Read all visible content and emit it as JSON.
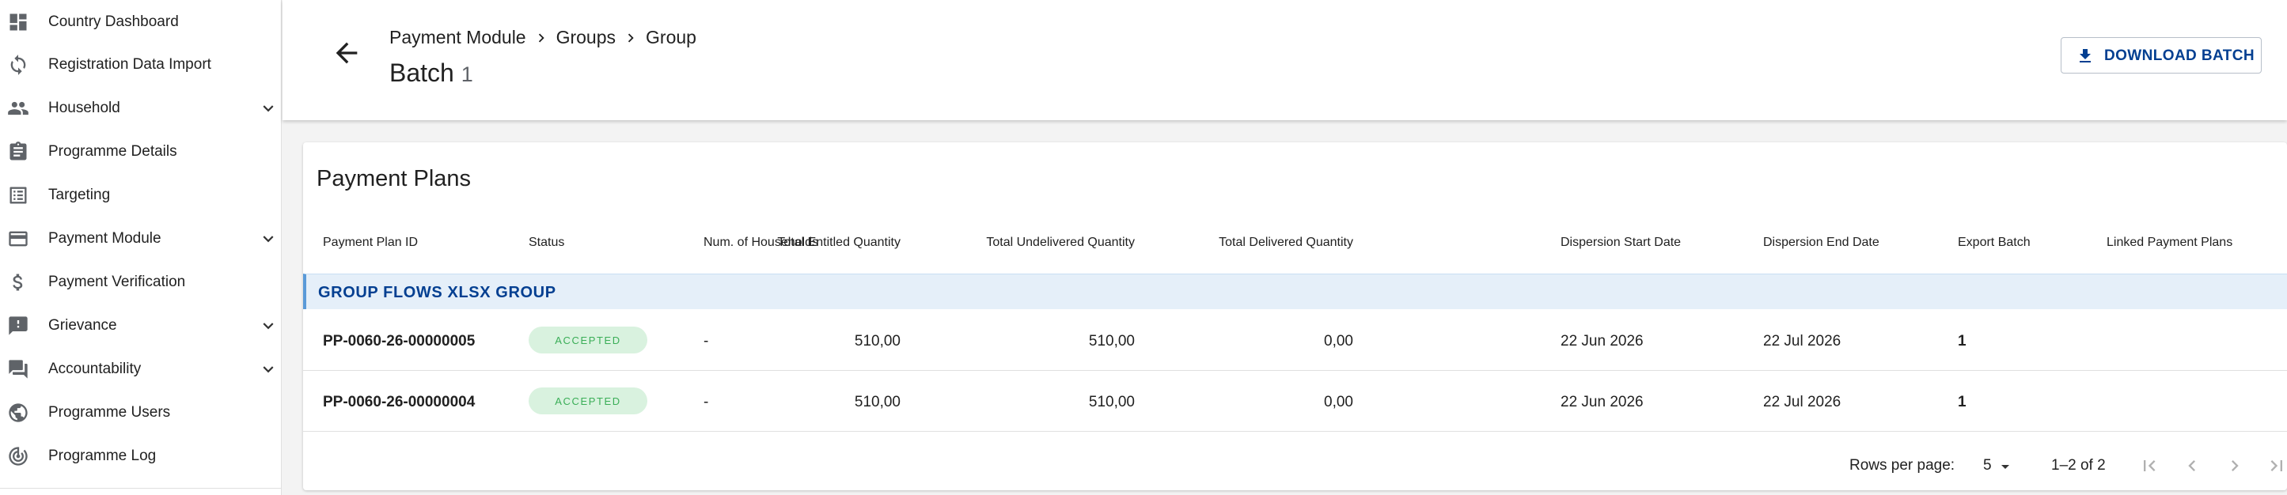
{
  "sidebar": {
    "items": [
      {
        "label": "Country Dashboard",
        "icon": "dashboard-icon",
        "expandable": false
      },
      {
        "label": "Registration Data Import",
        "icon": "refresh-icon",
        "expandable": false
      },
      {
        "label": "Household",
        "icon": "people-icon",
        "expandable": true
      },
      {
        "label": "Programme Details",
        "icon": "clipboard-icon",
        "expandable": false
      },
      {
        "label": "Targeting",
        "icon": "list-icon",
        "expandable": false
      },
      {
        "label": "Payment Module",
        "icon": "credit-card-icon",
        "expandable": true
      },
      {
        "label": "Payment Verification",
        "icon": "dollar-icon",
        "expandable": false
      },
      {
        "label": "Grievance",
        "icon": "feedback-icon",
        "expandable": true
      },
      {
        "label": "Accountability",
        "icon": "forum-icon",
        "expandable": true
      },
      {
        "label": "Programme Users",
        "icon": "globe-users-icon",
        "expandable": false
      },
      {
        "label": "Programme Log",
        "icon": "track-changes-icon",
        "expandable": false
      }
    ]
  },
  "header": {
    "breadcrumb": [
      "Payment Module",
      "Groups",
      "Group"
    ],
    "title": "Batch",
    "title_number": "1",
    "download_label": "DOWNLOAD BATCH"
  },
  "card": {
    "title": "Payment Plans",
    "columns": [
      "Payment Plan ID",
      "Status",
      "Num. of Households",
      "Total Entitled Quantity",
      "Total Undelivered Quantity",
      "Total Delivered Quantity",
      "Dispersion Start Date",
      "Dispersion End Date",
      "Export Batch",
      "Linked Payment Plans"
    ],
    "group_label": "GROUP FLOWS XLSX GROUP",
    "rows": [
      {
        "id": "PP-0060-26-00000005",
        "status": "ACCEPTED",
        "households": "-",
        "entitled": "510,00",
        "undelivered": "510,00",
        "delivered": "0,00",
        "start": "22 Jun 2026",
        "end": "22 Jul 2026",
        "export_batch": "1",
        "linked": ""
      },
      {
        "id": "PP-0060-26-00000004",
        "status": "ACCEPTED",
        "households": "-",
        "entitled": "510,00",
        "undelivered": "510,00",
        "delivered": "0,00",
        "start": "22 Jun 2026",
        "end": "22 Jul 2026",
        "export_batch": "1",
        "linked": ""
      }
    ]
  },
  "pagination": {
    "rows_per_page_label": "Rows per page:",
    "rows_per_page": "5",
    "range": "1–2 of 2"
  },
  "colors": {
    "accent": "#033f91",
    "group_bg": "#e5eff9",
    "status_bg": "#d9f2df",
    "status_text": "#3aae57"
  }
}
